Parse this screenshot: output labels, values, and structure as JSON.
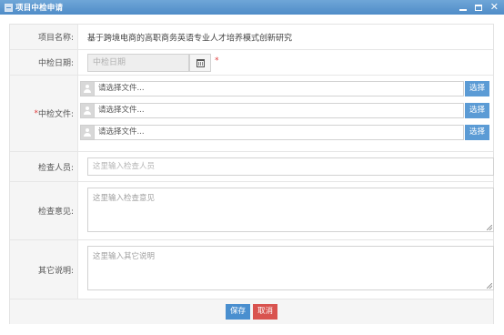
{
  "window": {
    "title": "项目中检申请",
    "icon": "form-icon",
    "controls": [
      "minimize",
      "maximize",
      "close"
    ]
  },
  "form": {
    "project_name": {
      "label": "项目名称:",
      "value": "基于跨境电商的高职商务英语专业人才培养模式创新研究"
    },
    "check_date": {
      "label": "中检日期:",
      "placeholder": "中检日期",
      "required_mark": "*"
    },
    "check_files": {
      "label": "中检文件:",
      "required_mark": "*",
      "files": [
        {
          "placeholder": "请选择文件...",
          "button": "选择"
        },
        {
          "placeholder": "请选择文件...",
          "button": "选择"
        },
        {
          "placeholder": "请选择文件...",
          "button": "选择"
        }
      ]
    },
    "inspector": {
      "label": "检查人员:",
      "placeholder": "这里输入检查人员"
    },
    "opinion": {
      "label": "检查意见:",
      "placeholder": "这里输入检查意见"
    },
    "other_notes": {
      "label": "其它说明:",
      "placeholder": "这里输入其它说明"
    }
  },
  "actions": {
    "save": "保存",
    "cancel": "取消"
  },
  "colors": {
    "titlebar": "#5b96d0",
    "primary_button": "#4a8fcf",
    "danger_button": "#d9534f",
    "required": "#e03c3c"
  }
}
